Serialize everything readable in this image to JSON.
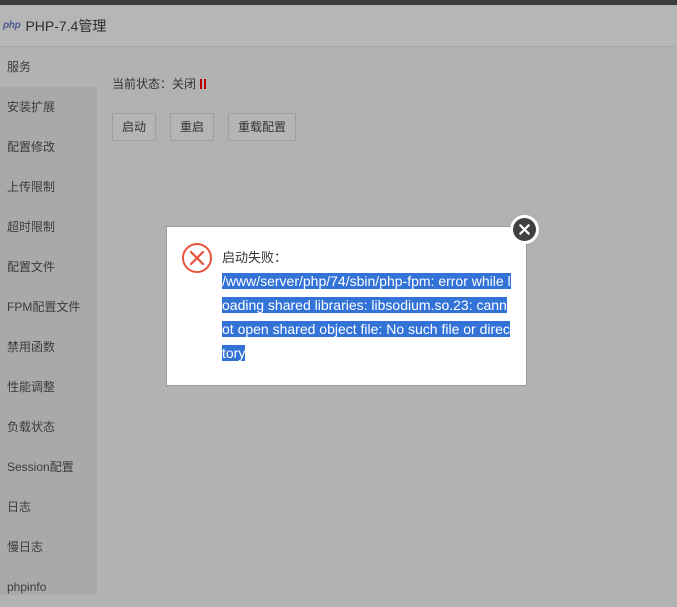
{
  "window": {
    "logo_text": "php",
    "title": "PHP-7.4管理"
  },
  "sidebar": {
    "items": [
      {
        "label": "服务",
        "active": true
      },
      {
        "label": "安装扩展"
      },
      {
        "label": "配置修改"
      },
      {
        "label": "上传限制"
      },
      {
        "label": "超时限制"
      },
      {
        "label": "配置文件"
      },
      {
        "label": "FPM配置文件"
      },
      {
        "label": "禁用函数"
      },
      {
        "label": "性能调整"
      },
      {
        "label": "负载状态"
      },
      {
        "label": "Session配置"
      },
      {
        "label": "日志"
      },
      {
        "label": "慢日志"
      },
      {
        "label": "phpinfo"
      }
    ]
  },
  "service": {
    "status_label": "当前状态：",
    "status_value": "关闭",
    "status_icon": "pause-icon",
    "status_color": "#c00000",
    "buttons": {
      "start": "启动",
      "restart": "重启",
      "reload": "重载配置"
    }
  },
  "dialog": {
    "icon": "error-icon",
    "label": "启动失败：",
    "message": "/www/server/php/74/sbin/php-fpm: error while loading shared libraries: libsodium.so.23: cannot open shared object file: No such file or directory",
    "close_icon": "close-icon",
    "accent_color": "#e8533c",
    "selection_color": "#3373d7"
  }
}
